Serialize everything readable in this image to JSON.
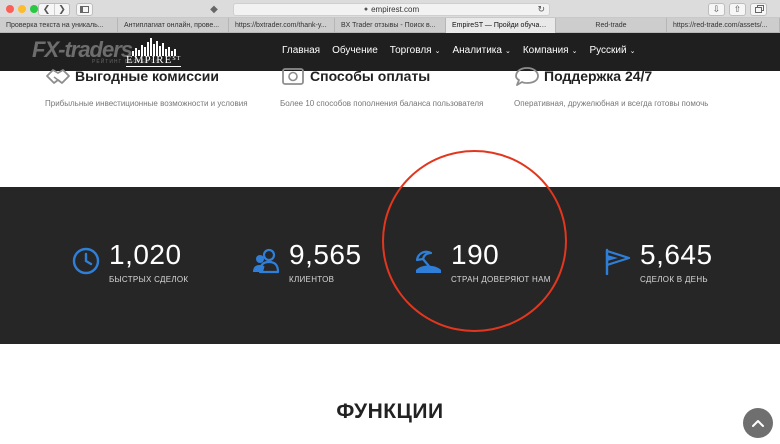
{
  "browser": {
    "url": "empirest.com",
    "tabs": [
      "Проверка текста на уникаль...",
      "Антиплагиат онлайн, прове...",
      "https://bxtrader.com/thank-y...",
      "BX Trader отзывы - Поиск в...",
      "EmpireST — Пройди обучаю...",
      "Red-trade",
      "https://red-trade.com/assets/..."
    ],
    "active_tab_index": 4
  },
  "watermark": {
    "text": "FX-traders",
    "sub": "РЕЙТИНГ БРОКЕРОВ"
  },
  "logo": {
    "text": "EMPIRE",
    "superscript": "ST"
  },
  "nav": {
    "items": [
      {
        "label": "Главная",
        "dropdown": false
      },
      {
        "label": "Обучение",
        "dropdown": false
      },
      {
        "label": "Торговля",
        "dropdown": true
      },
      {
        "label": "Аналитика",
        "dropdown": true
      },
      {
        "label": "Компания",
        "dropdown": true
      },
      {
        "label": "Русский",
        "dropdown": true
      }
    ]
  },
  "features": [
    {
      "title": "Выгодные комиссии",
      "description": "Прибыльные инвестиционные возможности и условия",
      "icon": "handshake-icon"
    },
    {
      "title": "Способы оплаты",
      "description": "Более 10 способов пополнения баланса пользователя",
      "icon": "payment-icon"
    },
    {
      "title": "Поддержка 24/7",
      "description": "Оперативная, дружелюбная и всегда готовы помочь",
      "icon": "chat-icon"
    }
  ],
  "stats": [
    {
      "number": "1,020",
      "label": "БЫСТРЫХ СДЕЛОК",
      "icon": "clock-icon"
    },
    {
      "number": "9,565",
      "label": "КЛИЕНТОВ",
      "icon": "users-icon"
    },
    {
      "number": "190",
      "label": "СТРАН ДОВЕРЯЮТ НАМ",
      "icon": "island-icon"
    },
    {
      "number": "5,645",
      "label": "СДЕЛОК В ДЕНЬ",
      "icon": "flag-icon"
    }
  ],
  "functions_heading": "ФУНКЦИИ",
  "colors": {
    "header_bg": "#1f1f1f",
    "stats_bg": "#262626",
    "accent_blue": "#2f7fd9",
    "highlight_red": "#e2371e"
  }
}
